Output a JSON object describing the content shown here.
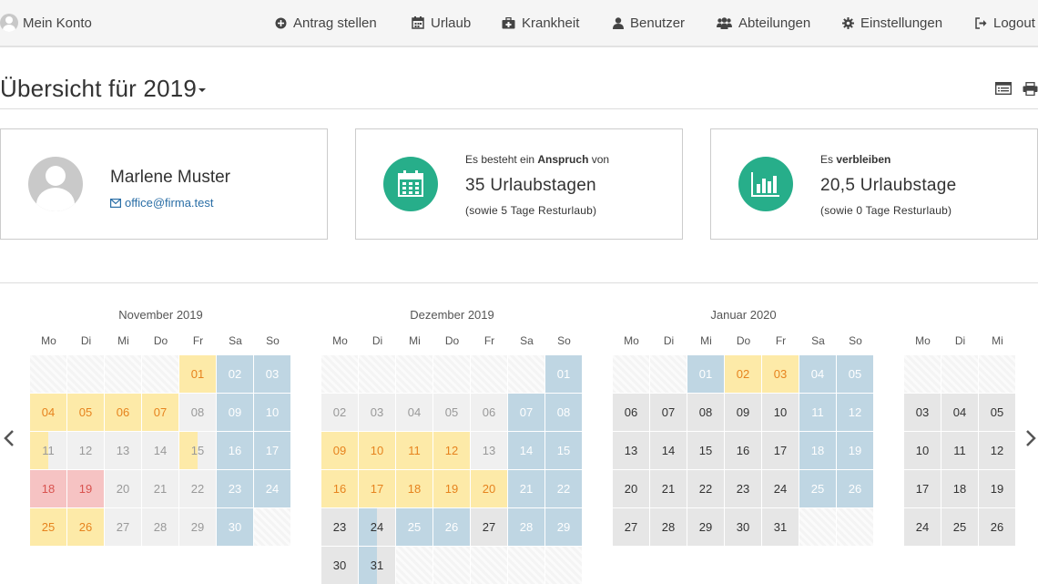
{
  "nav": {
    "account_label": "Mein Konto",
    "items": [
      {
        "label": "Antrag stellen",
        "icon": "plus-circle-icon"
      },
      {
        "label": "Urlaub",
        "icon": "calendar-icon"
      },
      {
        "label": "Krankheit",
        "icon": "medkit-icon"
      },
      {
        "label": "Benutzer",
        "icon": "user-icon"
      },
      {
        "label": "Abteilungen",
        "icon": "users-icon"
      },
      {
        "label": "Einstellungen",
        "icon": "gear-icon"
      },
      {
        "label": "Logout",
        "icon": "sign-out-icon"
      }
    ]
  },
  "header": {
    "title": "Übersicht für 2019",
    "icons": [
      "list-view-icon",
      "print-icon"
    ]
  },
  "profile": {
    "name": "Marlene Muster",
    "email": "office@firma.test"
  },
  "entitlement": {
    "prefix": "Es besteht ein ",
    "bold": "Anspruch",
    "suffix": " von",
    "value": "35 Urlaubstagen",
    "note": "(sowie 5 Tage Resturlaub)"
  },
  "remaining": {
    "prefix": "Es ",
    "bold": "verbleiben",
    "value": "20,5 Urlaubstage",
    "note": "(sowie 0 Tage Resturlaub)"
  },
  "colors": {
    "accent": "#27ae8a",
    "weekend": "#bfd6e3",
    "vacation": "#fdeaa8",
    "vacation_text": "#e6831e",
    "sick": "#f6c3c3",
    "sick_text": "#d9534f",
    "link": "#2a6ea6"
  },
  "weekdays": [
    "Mo",
    "Di",
    "Mi",
    "Do",
    "Fr",
    "Sa",
    "So"
  ],
  "months": [
    {
      "title": "November 2019",
      "cells": [
        [
          "",
          "e"
        ],
        [
          "",
          "e"
        ],
        [
          "",
          "e"
        ],
        [
          "",
          "e"
        ],
        [
          "01",
          "v"
        ],
        [
          "02",
          "w"
        ],
        [
          "03",
          "w"
        ],
        [
          "04",
          "v"
        ],
        [
          "05",
          "v"
        ],
        [
          "06",
          "v"
        ],
        [
          "07",
          "v"
        ],
        [
          "08",
          "p"
        ],
        [
          "09",
          "w"
        ],
        [
          "10",
          "w"
        ],
        [
          "11",
          "hl"
        ],
        [
          "12",
          "p"
        ],
        [
          "13",
          "p"
        ],
        [
          "14",
          "p"
        ],
        [
          "15",
          "hl"
        ],
        [
          "16",
          "w"
        ],
        [
          "17",
          "w"
        ],
        [
          "18",
          "s"
        ],
        [
          "19",
          "s"
        ],
        [
          "20",
          "p"
        ],
        [
          "21",
          "p"
        ],
        [
          "22",
          "p"
        ],
        [
          "23",
          "w"
        ],
        [
          "24",
          "w"
        ],
        [
          "25",
          "v"
        ],
        [
          "26",
          "v"
        ],
        [
          "27",
          "p"
        ],
        [
          "28",
          "p"
        ],
        [
          "29",
          "p"
        ],
        [
          "30",
          "w"
        ],
        [
          "",
          "e"
        ]
      ]
    },
    {
      "title": "Dezember 2019",
      "cells": [
        [
          "",
          "e"
        ],
        [
          "",
          "e"
        ],
        [
          "",
          "e"
        ],
        [
          "",
          "e"
        ],
        [
          "",
          "e"
        ],
        [
          "",
          "e"
        ],
        [
          "01",
          "w"
        ],
        [
          "02",
          "p"
        ],
        [
          "03",
          "p"
        ],
        [
          "04",
          "p"
        ],
        [
          "05",
          "p"
        ],
        [
          "06",
          "p"
        ],
        [
          "07",
          "w"
        ],
        [
          "08",
          "w"
        ],
        [
          "09",
          "v"
        ],
        [
          "10",
          "v"
        ],
        [
          "11",
          "v"
        ],
        [
          "12",
          "v"
        ],
        [
          "13",
          "p"
        ],
        [
          "14",
          "w"
        ],
        [
          "15",
          "w"
        ],
        [
          "16",
          "v"
        ],
        [
          "17",
          "v"
        ],
        [
          "18",
          "v"
        ],
        [
          "19",
          "v"
        ],
        [
          "20",
          "v"
        ],
        [
          "21",
          "w"
        ],
        [
          "22",
          "w"
        ],
        [
          "23",
          "k"
        ],
        [
          "24",
          "hb"
        ],
        [
          "25",
          "w"
        ],
        [
          "26",
          "w"
        ],
        [
          "27",
          "k"
        ],
        [
          "28",
          "w"
        ],
        [
          "29",
          "w"
        ],
        [
          "30",
          "k"
        ],
        [
          "31",
          "hb"
        ],
        [
          "",
          "e"
        ],
        [
          "",
          "e"
        ],
        [
          "",
          "e"
        ],
        [
          "",
          "e"
        ],
        [
          "",
          "e"
        ]
      ]
    },
    {
      "title": "Januar 2020",
      "cells": [
        [
          "",
          "e"
        ],
        [
          "",
          "e"
        ],
        [
          "01",
          "w"
        ],
        [
          "02",
          "v"
        ],
        [
          "03",
          "v"
        ],
        [
          "04",
          "w"
        ],
        [
          "05",
          "w"
        ],
        [
          "06",
          "k"
        ],
        [
          "07",
          "k"
        ],
        [
          "08",
          "k"
        ],
        [
          "09",
          "k"
        ],
        [
          "10",
          "k"
        ],
        [
          "11",
          "w"
        ],
        [
          "12",
          "w"
        ],
        [
          "13",
          "k"
        ],
        [
          "14",
          "k"
        ],
        [
          "15",
          "k"
        ],
        [
          "16",
          "k"
        ],
        [
          "17",
          "k"
        ],
        [
          "18",
          "w"
        ],
        [
          "19",
          "w"
        ],
        [
          "20",
          "k"
        ],
        [
          "21",
          "k"
        ],
        [
          "22",
          "k"
        ],
        [
          "23",
          "k"
        ],
        [
          "24",
          "k"
        ],
        [
          "25",
          "w"
        ],
        [
          "26",
          "w"
        ],
        [
          "27",
          "k"
        ],
        [
          "28",
          "k"
        ],
        [
          "29",
          "k"
        ],
        [
          "30",
          "k"
        ],
        [
          "31",
          "k"
        ],
        [
          "",
          "e"
        ],
        [
          "",
          "e"
        ]
      ]
    },
    {
      "title": "",
      "cells": [
        [
          "",
          "e"
        ],
        [
          "",
          "e"
        ],
        [
          "",
          "e"
        ],
        [
          "03",
          "k"
        ],
        [
          "04",
          "k"
        ],
        [
          "05",
          "k"
        ],
        [
          "10",
          "k"
        ],
        [
          "11",
          "k"
        ],
        [
          "12",
          "k"
        ],
        [
          "17",
          "k"
        ],
        [
          "18",
          "k"
        ],
        [
          "19",
          "k"
        ],
        [
          "24",
          "k"
        ],
        [
          "25",
          "k"
        ],
        [
          "26",
          "k"
        ]
      ],
      "cols": 3
    }
  ],
  "pager": {
    "prev": "previous-months-arrow",
    "next": "next-months-arrow"
  }
}
